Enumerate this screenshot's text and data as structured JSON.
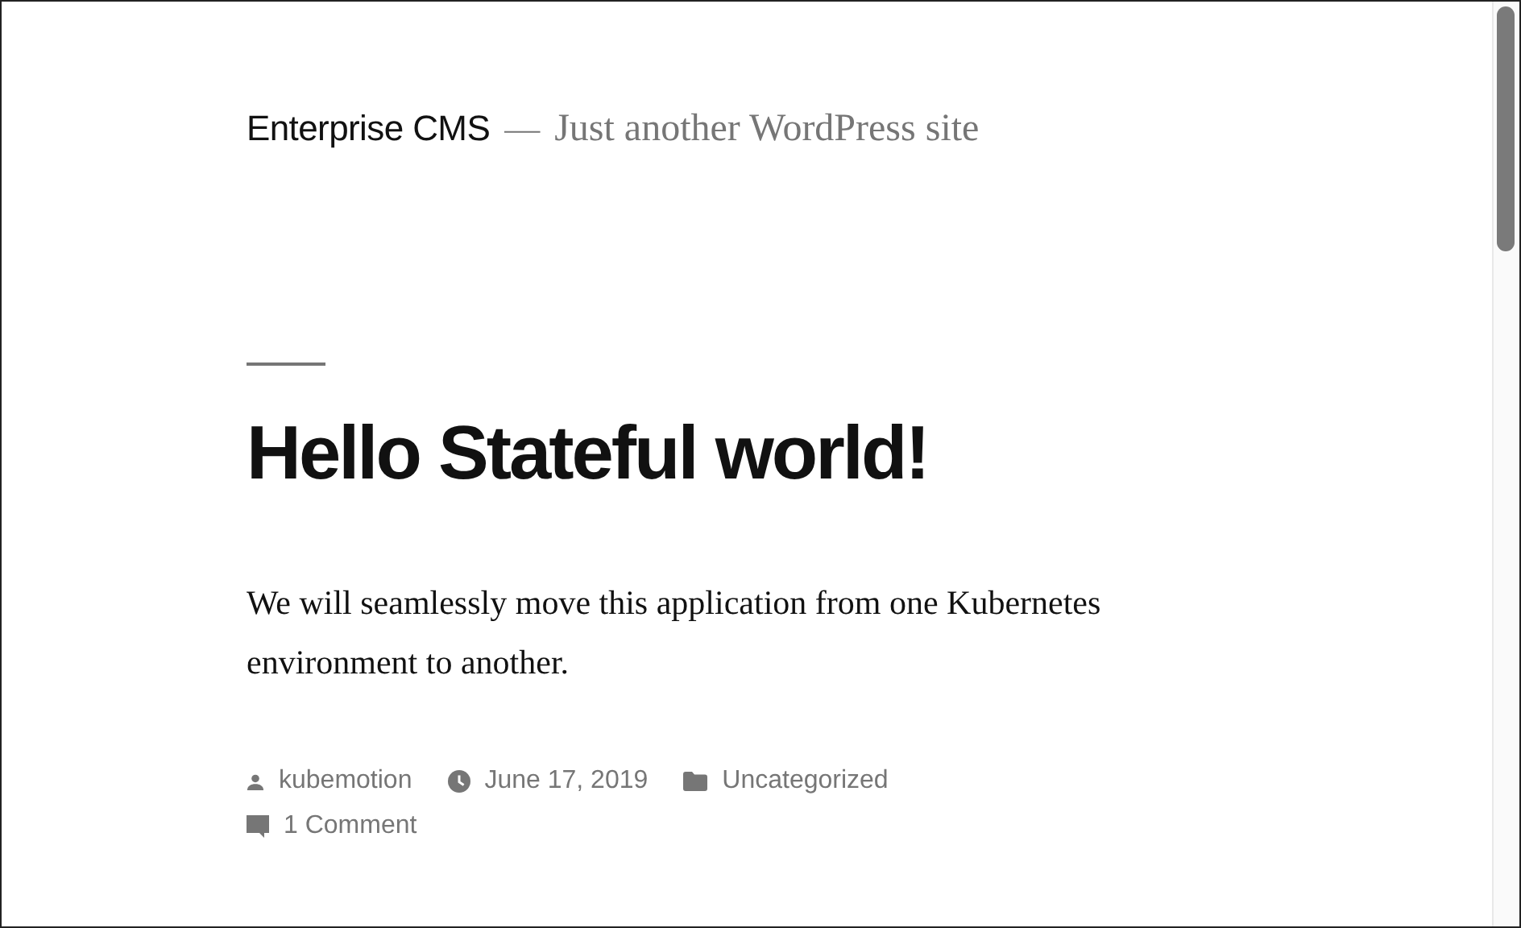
{
  "site": {
    "title": "Enterprise CMS",
    "separator": "—",
    "tagline": "Just another WordPress site"
  },
  "post": {
    "title": "Hello Stateful world!",
    "body": "We will seamlessly move this application from one Kubernetes environment to another.",
    "meta": [
      {
        "kind": "author",
        "text": "kubemotion"
      },
      {
        "kind": "date",
        "text": "June 17, 2019"
      },
      {
        "kind": "category",
        "text": "Uncategorized"
      },
      {
        "kind": "comments",
        "text": "1 Comment"
      }
    ]
  }
}
